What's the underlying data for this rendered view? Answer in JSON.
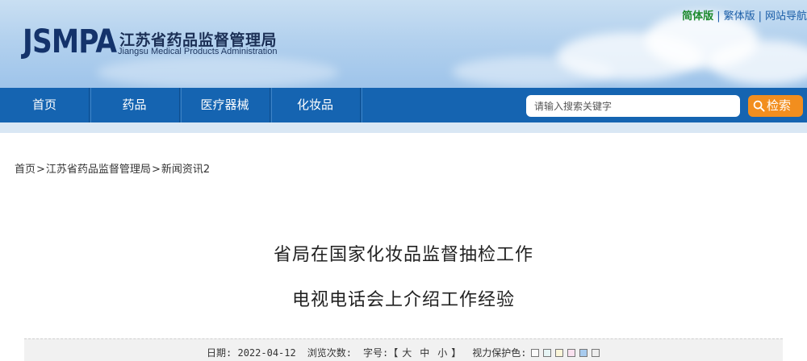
{
  "header": {
    "logo_text": "JSMPA",
    "org_name_cn": "江苏省药品监督管理局",
    "org_name_en": "Jiangsu Medical Products Administration",
    "top_links": {
      "simplified": "简体版",
      "traditional": "繁体版",
      "site_nav": "网站导航",
      "separator": "|"
    }
  },
  "nav": {
    "items": [
      {
        "label": "首页"
      },
      {
        "label": "药品"
      },
      {
        "label": "医疗器械"
      },
      {
        "label": "化妆品"
      }
    ],
    "search": {
      "placeholder": "请输入搜索关键字",
      "button_label": "检索",
      "icon": "search-icon"
    }
  },
  "breadcrumb": {
    "items": [
      "首页",
      "江苏省药品监督管理局",
      "新闻资讯2"
    ],
    "separator": ">"
  },
  "article": {
    "title_line1": "省局在国家化妆品监督抽检工作",
    "title_line2": "电视电话会上介绍工作经验",
    "info": {
      "date_label": "日期:",
      "date_value": "2022-04-12",
      "views_label": "浏览次数:",
      "font_label": "字号:",
      "bracket_open": "【",
      "font_large": "大",
      "font_medium": "中",
      "font_small": "小",
      "bracket_close": "】",
      "eye_care_label": "视力保护色:",
      "eye_care_colors": [
        "#fafafa",
        "#e6f5f5",
        "#fbf6d9",
        "#f9e1ef",
        "#a8cbee",
        "#eeeeee"
      ]
    }
  },
  "colors": {
    "nav_bg": "#1564b1",
    "search_button": "#f28e1e",
    "logo": "#14336b",
    "simplified_link": "#1d8a2e",
    "link_blue": "#1b5ea8"
  }
}
